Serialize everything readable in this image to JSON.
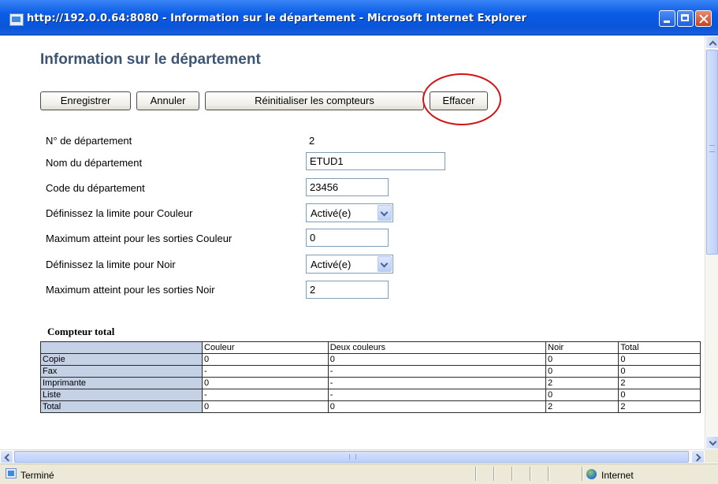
{
  "window": {
    "title": "http://192.0.0.64:8080 - Information sur le département - Microsoft Internet Explorer"
  },
  "page": {
    "title": "Information sur le département"
  },
  "toolbar": {
    "save_label": "Enregistrer",
    "cancel_label": "Annuler",
    "reset_label": "Réinitialiser les compteurs",
    "erase_label": "Effacer"
  },
  "form": {
    "dept_number_label": "N° de département",
    "dept_number_value": "2",
    "dept_name_label": "Nom du département",
    "dept_name_value": "ETUD1",
    "dept_code_label": "Code du département",
    "dept_code_value": "23456",
    "color_limit_label": "Définissez la limite pour Couleur",
    "color_limit_value": "Activé(e)",
    "color_max_label": "Maximum atteint pour les sorties Couleur",
    "color_max_value": "0",
    "black_limit_label": "Définissez la limite pour Noir",
    "black_limit_value": "Activé(e)",
    "black_max_label": "Maximum atteint pour les sorties Noir",
    "black_max_value": "2"
  },
  "counter": {
    "title": "Compteur total",
    "headers": [
      "",
      "Couleur",
      "Deux couleurs",
      "Noir",
      "Total"
    ],
    "rows": [
      [
        "Copie",
        "0",
        "0",
        "0",
        "0"
      ],
      [
        "Fax",
        "-",
        "-",
        "0",
        "0"
      ],
      [
        "Imprimante",
        "0",
        "-",
        "2",
        "2"
      ],
      [
        "Liste",
        "-",
        "-",
        "0",
        "0"
      ],
      [
        "Total",
        "0",
        "0",
        "2",
        "2"
      ]
    ]
  },
  "status": {
    "text": "Terminé",
    "zone": "Internet"
  },
  "colors": {
    "titlebar": "#0a5ce6",
    "page_title": "#3c5572",
    "annotation_circle": "#d21414",
    "table_header_bg": "#c5d2e6"
  },
  "icons": {
    "title": "ie-page-icon",
    "status": "ie-page-icon",
    "zone": "globe-icon"
  }
}
